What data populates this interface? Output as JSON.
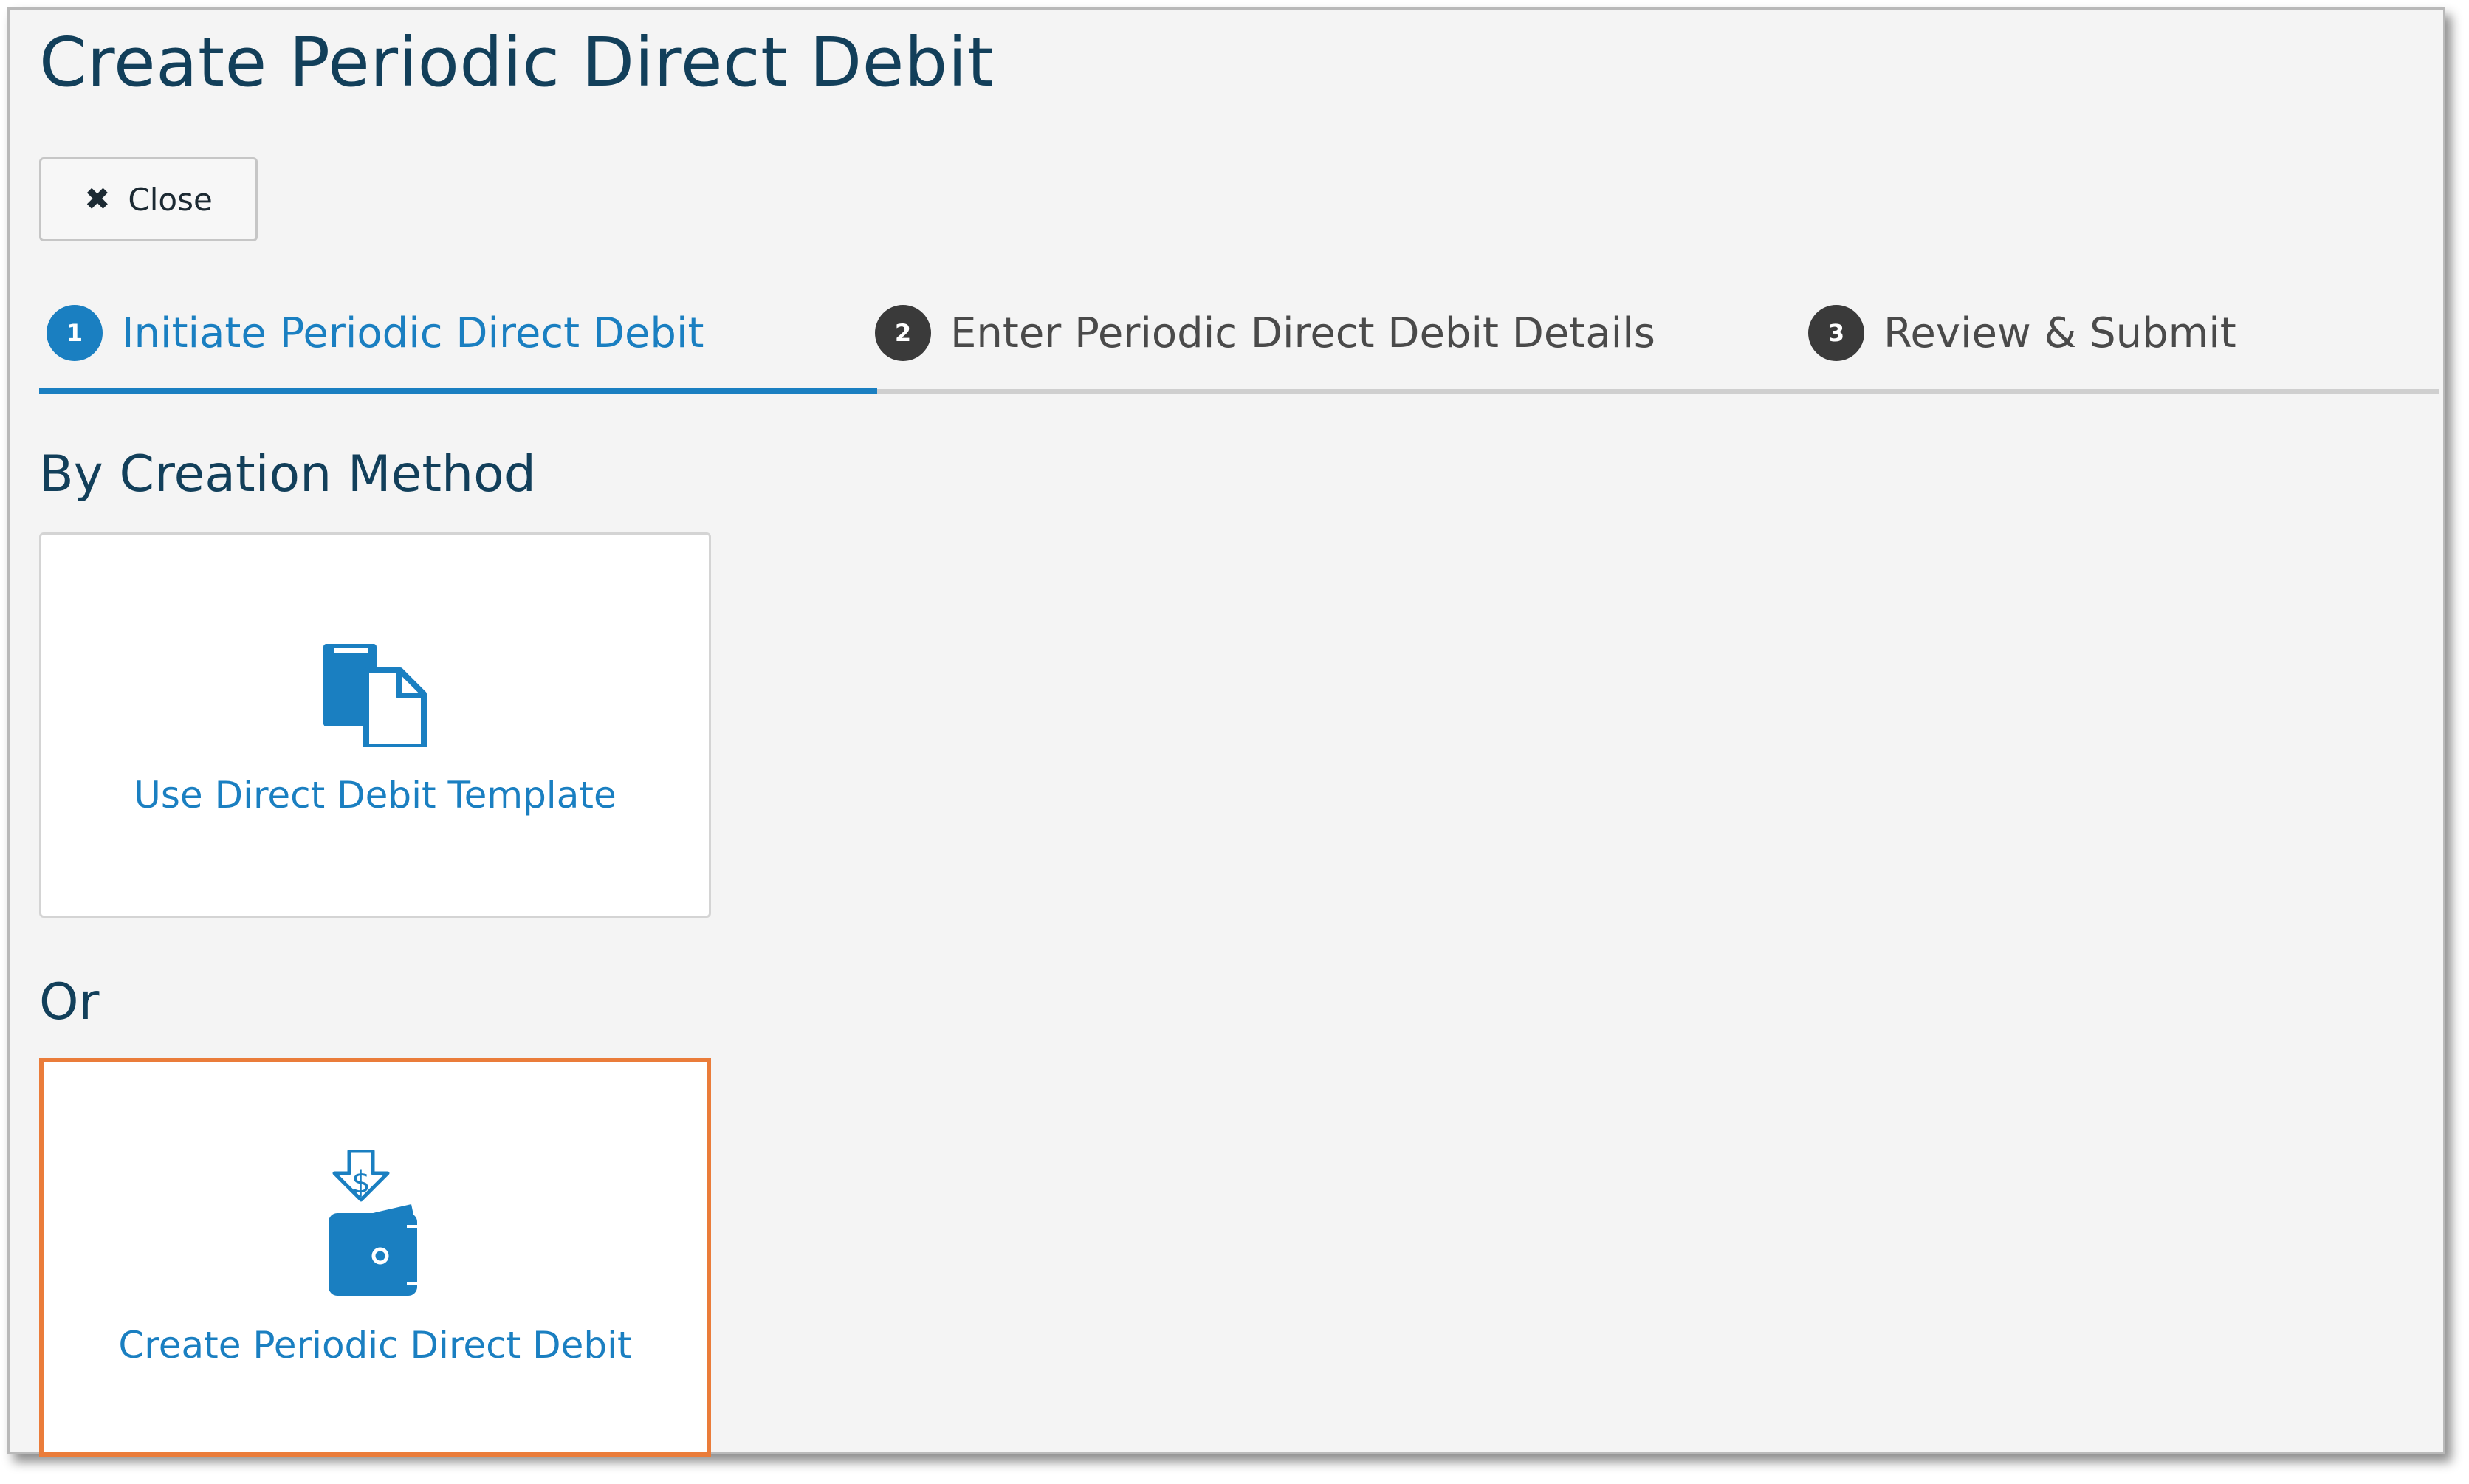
{
  "page": {
    "title": "Create Periodic Direct Debit"
  },
  "toolbar": {
    "close_label": "Close"
  },
  "stepper": {
    "steps": [
      {
        "number": "1",
        "label": "Initiate Periodic Direct Debit",
        "active": true
      },
      {
        "number": "2",
        "label": "Enter Periodic Direct Debit Details",
        "active": false
      },
      {
        "number": "3",
        "label": "Review & Submit",
        "active": false
      }
    ]
  },
  "creation": {
    "section_title": "By Creation Method",
    "template_option": {
      "label": "Use Direct Debit Template",
      "icon": "document-copy-icon"
    },
    "or_label": "Or",
    "create_option": {
      "label": "Create Periodic Direct Debit",
      "icon": "wallet-dollar-icon"
    }
  },
  "colors": {
    "accent": "#1a7fc1",
    "title": "#123f5a",
    "highlight_border": "#ea7c3a",
    "background": "#f4f4f4"
  }
}
